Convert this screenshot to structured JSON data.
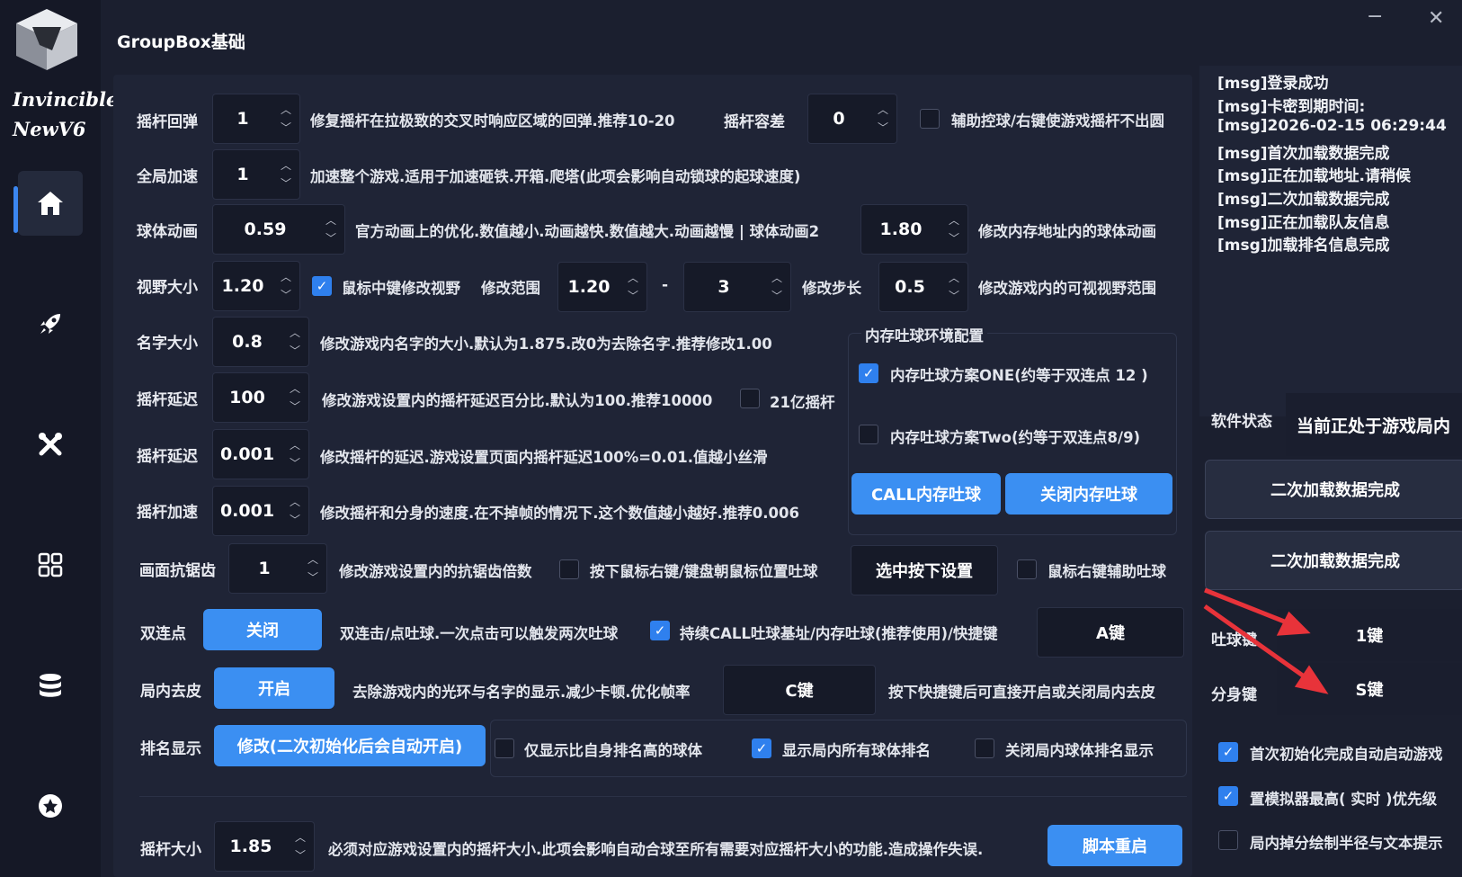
{
  "app": {
    "logo_line1": "Invincible",
    "logo_line2": "NewV6",
    "title": "GroupBox基础",
    "minimize": "−",
    "close": "✕"
  },
  "sidebar": {
    "items": [
      {
        "icon": "home-icon",
        "active": true
      },
      {
        "icon": "rocket-icon",
        "active": false
      },
      {
        "icon": "tools-icon",
        "active": false
      },
      {
        "icon": "grid-icon",
        "active": false
      },
      {
        "icon": "database-icon",
        "active": false
      },
      {
        "icon": "badge-icon",
        "active": false
      }
    ]
  },
  "settings": {
    "joystick_rebound": {
      "label": "摇杆回弹",
      "value": "1",
      "desc": "修复摇杆在拉极致的交叉时响应区域的回弹.推荐10-20"
    },
    "joystick_tolerance": {
      "label": "摇杆容差",
      "value": "0"
    },
    "assist_ctrl": {
      "label": "辅助控球/右键使游戏摇杆不出圆",
      "checked": false
    },
    "global_speed": {
      "label": "全局加速",
      "value": "1",
      "desc": "加速整个游戏.适用于加速砸铁.开箱.爬塔(此项会影响自动锁球的起球速度)"
    },
    "ball_anim": {
      "label": "球体动画",
      "value": "0.59",
      "desc": "官方动画上的优化.数值越小.动画越快.数值越大.动画越慢 | 球体动画2"
    },
    "ball_anim2": {
      "value": "1.80",
      "desc": "修改内存地址内的球体动画"
    },
    "view_size": {
      "label": "视野大小",
      "value": "1.20"
    },
    "mouse_mid_view": {
      "label": "鼠标中键修改视野",
      "checked": true
    },
    "modify_range": {
      "label": "修改范围",
      "min": "1.20",
      "dash": "-",
      "max": "3"
    },
    "modify_step": {
      "label": "修改步长",
      "value": "0.5",
      "desc": "修改游戏内的可视视野范围"
    },
    "name_size": {
      "label": "名字大小",
      "value": "0.8",
      "desc": "修改游戏内名字的大小.默认为1.875.改0为去除名字.推荐修改1.00"
    },
    "joystick_delay": {
      "label": "摇杆延迟",
      "value": "100",
      "desc": "修改游戏设置内的摇杆延迟百分比.默认为100.推荐10000"
    },
    "billion_joystick": {
      "label": "21亿摇杆",
      "checked": false
    },
    "joystick_delay2": {
      "label": "摇杆延迟",
      "value": "0.001",
      "desc": "修改摇杆的延迟.游戏设置页面内摇杆延迟100%=0.01.值越小丝滑"
    },
    "joystick_accel": {
      "label": "摇杆加速",
      "value": "0.001",
      "desc": "修改摇杆和分身的速度.在不掉帧的情况下.这个数值越小越好.推荐0.006"
    },
    "antialias": {
      "label": "画面抗锯齿",
      "value": "1",
      "desc": "修改游戏设置内的抗锯齿倍数"
    },
    "right_click_spit": {
      "label": "按下鼠标右键/键盘朝鼠标位置吐球",
      "checked": false
    },
    "select_key_btn": "选中按下设置",
    "right_click_assist": {
      "label": "鼠标右键辅助吐球",
      "checked": false
    },
    "double_click": {
      "label": "双连点",
      "button": "关闭",
      "desc": "双连击/点吐球.一次点击可以触发两次吐球"
    },
    "continuous_call": {
      "label": "持续CALL吐球基址/内存吐球(推荐使用)/快捷键",
      "checked": true,
      "key": "A键"
    },
    "skin_remove": {
      "label": "局内去皮",
      "button": "开启",
      "desc": "去除游戏内的光环与名字的显示.减少卡顿.优化帧率",
      "key": "C键",
      "desc2": "按下快捷键后可直接开启或关闭局内去皮"
    },
    "rank_display": {
      "label": "排名显示",
      "button": "修改(二次初始化后会自动开启)"
    },
    "rank_higher_only": {
      "label": "仅显示比自身排名高的球体",
      "checked": false
    },
    "rank_show_all": {
      "label": "显示局内所有球体排名",
      "checked": true
    },
    "rank_close": {
      "label": "关闭局内球体排名显示",
      "checked": false
    },
    "joystick_size": {
      "label": "摇杆大小",
      "value": "1.85",
      "desc": "必须对应游戏设置内的摇杆大小.此项会影响自动合球至所有需要对应摇杆大小的功能.造成操作失误."
    },
    "restart_btn": "脚本重启"
  },
  "memory_group": {
    "title": "内存吐球环境配置",
    "option_one": {
      "label": "内存吐球方案ONE(约等于双连点 12 )",
      "checked": true
    },
    "option_two": {
      "label": "内存吐球方案Two(约等于双连点8/9)",
      "checked": false
    },
    "call_btn": "CALL内存吐球",
    "close_btn": "关闭内存吐球"
  },
  "log": {
    "lines": [
      "[msg]登录成功",
      "[msg]卡密到期时间:",
      "[msg]2026-02-15 06:29:44",
      "[msg]首次加载数据完成",
      "[msg]正在加载地址.请稍候",
      "[msg]二次加载数据完成",
      "[msg]正在加载队友信息",
      "[msg]加载排名信息完成"
    ]
  },
  "right": {
    "status_label": "软件状态",
    "status_value": "当前正处于游戏局内",
    "btn1": "二次加载数据完成",
    "btn2": "二次加载数据完成",
    "spit_key_label": "吐球键",
    "spit_key_value": "1键",
    "split_key_label": "分身键",
    "split_key_value": "S键",
    "opt_autostart": {
      "label": "首次初始化完成自动启动游戏",
      "checked": true
    },
    "opt_priority": {
      "label": "置模拟器最高( 实时 )优先级",
      "checked": true
    },
    "opt_draw_radius": {
      "label": "局内掉分绘制半径与文本提示",
      "checked": false
    }
  },
  "colors": {
    "accent": "#3b8ff2",
    "annotation_arrow": "#e8333a"
  }
}
